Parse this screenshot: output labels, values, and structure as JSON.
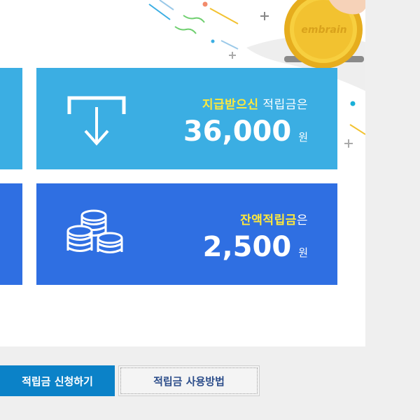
{
  "brand": {
    "coin_text": "embrain"
  },
  "cards": {
    "paid": {
      "label_highlight": "지급받으신",
      "label_rest": " 적립금은",
      "amount": "36,000",
      "unit": "원",
      "icon": "download-tray-icon"
    },
    "balance": {
      "label_highlight": "잔액적립금",
      "label_rest": "은",
      "amount": "2,500",
      "unit": "원",
      "icon": "coin-stack-icon"
    }
  },
  "buttons": {
    "apply_label": "적립금 신청하기",
    "howto_label": "적립금 사용방법"
  },
  "colors": {
    "paid_card": "#3baee3",
    "balance_card": "#2f6fe2",
    "highlight": "#ffe93b",
    "apply_button": "#0b82c8",
    "coin": "#f2c230"
  }
}
